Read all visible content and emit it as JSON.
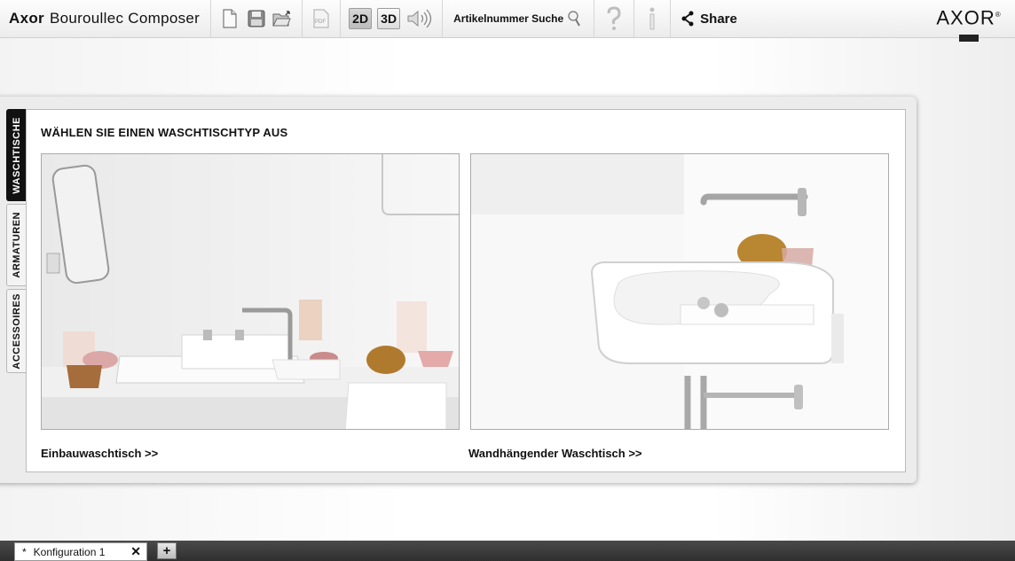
{
  "toolbar": {
    "brand": "Axor",
    "product": "Bouroullec Composer",
    "pdf_label": "PDF",
    "view_2d": "2D",
    "view_3d": "3D",
    "search_label": "Artikelnummer Suche",
    "share_label": "Share"
  },
  "logo": {
    "text": "AXOR",
    "registered": "®"
  },
  "side_tabs": [
    {
      "label": "WASCHTISCHE",
      "active": true
    },
    {
      "label": "ARMATUREN",
      "active": false
    },
    {
      "label": "ACCESSOIRES",
      "active": false
    }
  ],
  "main": {
    "title": "WÄHLEN SIE EINEN WASCHTISCHTYP AUS",
    "options": [
      {
        "label": "Einbauwaschtisch >>"
      },
      {
        "label": "Wandhängender Waschtisch >>"
      }
    ]
  },
  "tabs": {
    "dirty_marker": "*",
    "active_tab": "Konfiguration 1",
    "close_symbol": "✕",
    "add_symbol": "+"
  },
  "colors": {
    "active_tab_bg": "#111111",
    "tabbar_bg": "#3a3a3a"
  }
}
